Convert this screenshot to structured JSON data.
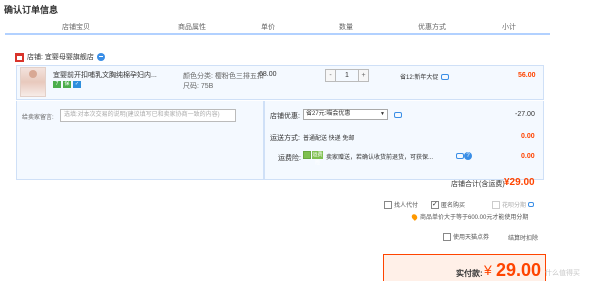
{
  "page": {
    "title": "确认订单信息"
  },
  "table_header": {
    "col_item": "店铺宝贝",
    "col_attr": "商品属性",
    "col_price": "单价",
    "col_qty": "数量",
    "col_discount": "优惠方式",
    "col_subtotal": "小计"
  },
  "shop": {
    "label": "店铺: 宜婴母婴旗舰店"
  },
  "item": {
    "name": "宜婴前开扣哺乳文胸纯棉孕妇内...",
    "badges": [
      "7",
      "保",
      "✓"
    ],
    "badge_colors": [
      "#4cae4c",
      "#4cae4c",
      "#2f8fdd"
    ],
    "attr_color": "颜色分类: 樱粉色三排五扣",
    "attr_size": "尺码: 75B",
    "price": "68.00",
    "quantity": "1",
    "qty_minus": "-",
    "qty_plus": "+",
    "promo": "省12:新年大促",
    "subtotal": "56.00"
  },
  "message": {
    "label": "给卖家留言:",
    "placeholder": "选填:对本次交易的说明(建议填写已和卖家协商一致的内容)"
  },
  "shop_discount": {
    "label": "店铺优惠:",
    "selected": "省27元:喵会优惠",
    "value": "-27.00"
  },
  "shipping": {
    "label": "运送方式:",
    "value": "普通配送 快递 免邮",
    "amount": "0.00"
  },
  "insurance": {
    "label": "运费险:",
    "tag": "运费险",
    "text": "卖家赠送，若确认收货前退货，可获保...",
    "amount": "0.00"
  },
  "shop_total": {
    "label": "店铺合计(含运费)",
    "value": "¥29.00"
  },
  "options": {
    "find_pay": "找人代付",
    "anonymous": "匿名购买",
    "huabei": "花呗分期",
    "installment_note": "商品单价大于等于600.00元才能使用分期",
    "tmall_points": "使用天猫点券",
    "settle_later": "结算时扣除"
  },
  "payment": {
    "label": "实付款:",
    "currency": "¥",
    "amount": "29.00"
  },
  "watermark": "什么值得买"
}
